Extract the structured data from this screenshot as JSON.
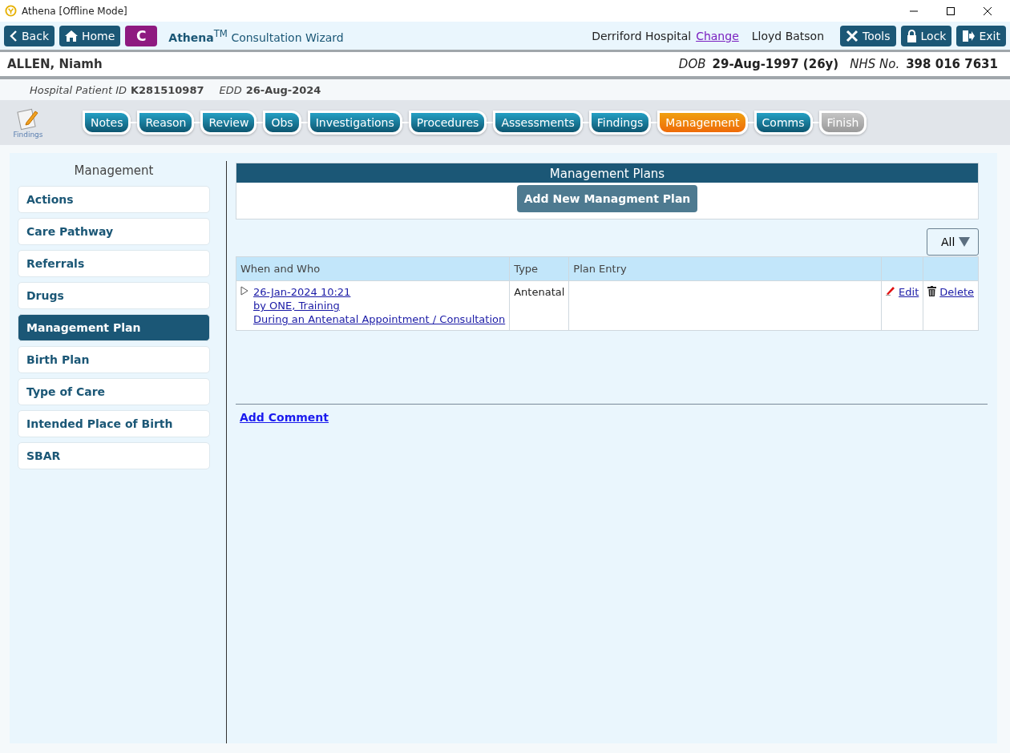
{
  "window": {
    "title": "Athena [Offline Mode]"
  },
  "toolbar": {
    "back": "Back",
    "home": "Home",
    "badge": "C",
    "app_title": "**Athena**$^{TM}$ Consultation Wizard",
    "hospital": "Derriford Hospital",
    "change_link": "Change",
    "user": "Lloyd Batson",
    "buttons": [
      {
        "kind": "tools",
        "label": "Tools"
      },
      {
        "kind": "lock",
        "label": "Lock"
      },
      {
        "kind": "exit",
        "label": "Exit"
      }
    ]
  },
  "patient": {
    "name": "ALLEN, Niamh",
    "dob_label": "DOB",
    "dob": "29-Aug-1997 (26y)",
    "nhs_label": "NHS No.",
    "nhs": "398 016 7631",
    "id_label": "Hospital Patient ID",
    "id": "K281510987",
    "edd_label": "EDD",
    "edd": "26-Aug-2024"
  },
  "stage_icon_label": "Findings",
  "steps": [
    {
      "label": "Notes",
      "selected": false,
      "disabled": false
    },
    {
      "label": "Reason",
      "selected": false,
      "disabled": false
    },
    {
      "label": "Review",
      "selected": false,
      "disabled": false
    },
    {
      "label": "Obs",
      "selected": false,
      "disabled": false
    },
    {
      "label": "Investigations",
      "selected": false,
      "disabled": false
    },
    {
      "label": "Procedures",
      "selected": false,
      "disabled": false
    },
    {
      "label": "Assessments",
      "selected": false,
      "disabled": false
    },
    {
      "label": "Findings",
      "selected": false,
      "disabled": false
    },
    {
      "label": "Management",
      "selected": true,
      "disabled": false
    },
    {
      "label": "Comms",
      "selected": false,
      "disabled": false
    },
    {
      "label": "Finish",
      "selected": false,
      "disabled": true
    }
  ],
  "sidebar": {
    "title": "Management",
    "items": [
      {
        "label": "Actions",
        "selected": false
      },
      {
        "label": "Care Pathway",
        "selected": false
      },
      {
        "label": "Referrals",
        "selected": false
      },
      {
        "label": "Drugs",
        "selected": false
      },
      {
        "label": "Management Plan",
        "selected": true
      },
      {
        "label": "Birth Plan",
        "selected": false
      },
      {
        "label": "Type of Care",
        "selected": false
      },
      {
        "label": "Intended Place of Birth",
        "selected": false
      },
      {
        "label": "SBAR",
        "selected": false
      }
    ]
  },
  "plans": {
    "title": "Management Plans",
    "add_button": "Add New Managment Plan",
    "filter": "All"
  },
  "table": {
    "columns": [
      "When and Who",
      "Type",
      "Plan Entry"
    ],
    "rows": [
      {
        "when": "26-Jan-2024 10:21",
        "who": "by ONE, Training",
        "context": "During an Antenatal Appointment / Consultation",
        "type": "Antenatal",
        "plan_entry": "",
        "edit": "Edit",
        "delete": "Delete"
      }
    ]
  },
  "add_comment": "Add Comment"
}
